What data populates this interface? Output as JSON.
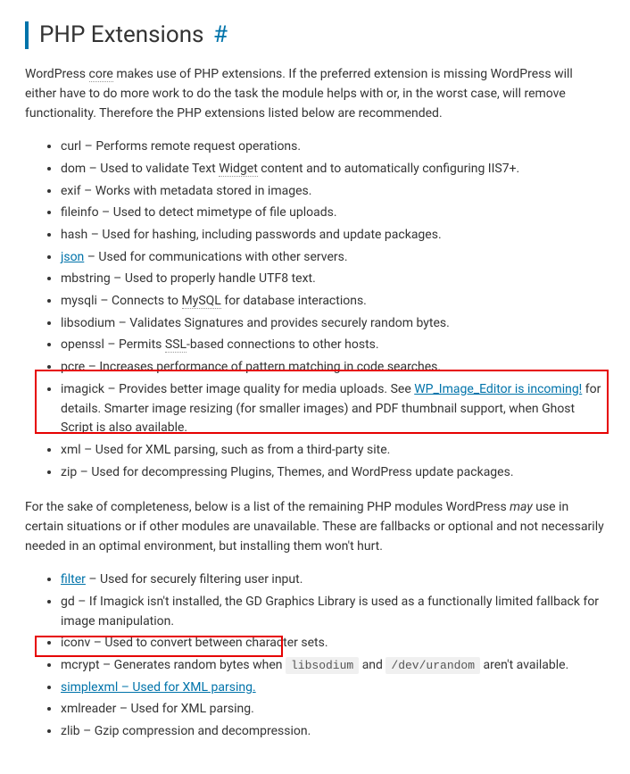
{
  "heading": {
    "title": "PHP Extensions",
    "anchor": "#"
  },
  "intro": {
    "p1_a": "WordPress ",
    "p1_core": "core",
    "p1_b": " makes use of PHP extensions. If the preferred extension is missing WordPress will either have to do more work to do the task the module helps with or, in the worst case, will remove functionality. Therefore the PHP extensions listed below are recommended."
  },
  "list1": {
    "i0": "curl – Performs remote request operations.",
    "i1_a": "dom – Used to validate Text ",
    "i1_widget": "Widget",
    "i1_b": " content and to automatically configuring IIS7+.",
    "i2": "exif – Works with metadata stored in images.",
    "i3": "fileinfo – Used to detect mimetype of file uploads.",
    "i4": "hash – Used for hashing, including passwords and update packages.",
    "i5_link": "json",
    "i5_b": " – Used for communications with other servers.",
    "i6": "mbstring – Used to properly handle UTF8 text.",
    "i7_a": "mysqli – Connects to ",
    "i7_mysql": "MySQL",
    "i7_b": " for database interactions.",
    "i8": "libsodium – Validates Signatures and provides securely random bytes.",
    "i9_a": "openssl – Permits ",
    "i9_ssl": "SSL",
    "i9_b": "-based connections to other hosts.",
    "i10": "pcre – Increases performance of pattern matching in code searches.",
    "i11_a": "imagick – Provides better image quality for media uploads. See ",
    "i11_link": "WP_Image_Editor is incoming!",
    "i11_b": " for details. Smarter image resizing (for smaller images) and PDF thumbnail support, when Ghost Script is also available.",
    "i12": "xml – Used for XML parsing, such as from a third-party site.",
    "i13": "zip – Used for decompressing Plugins, Themes, and WordPress update packages."
  },
  "mid": {
    "p2_a": "For the sake of completeness, below is a list of the remaining PHP modules WordPress ",
    "p2_may": "may",
    "p2_b": " use in certain situations or if other modules are unavailable. These are fallbacks or optional and not necessarily needed in an optimal environment, but installing them won't hurt."
  },
  "list2": {
    "i0_link": "filter",
    "i0_b": " – Used for securely filtering user input.",
    "i1": "gd – If Imagick isn't installed, the GD Graphics Library is used as a functionally limited fallback for image manipulation.",
    "i2": "iconv – Used to convert between character sets.",
    "i3_a": "mcrypt – Generates random bytes when ",
    "i3_code1": "libsodium",
    "i3_mid": " and ",
    "i3_code2": "/dev/urandom",
    "i3_b": " aren't available.",
    "i4_link": "simplexml – Used for XML parsing.",
    "i5": "xmlreader – Used for XML parsing.",
    "i6": "zlib – Gzip compression and decompression."
  }
}
